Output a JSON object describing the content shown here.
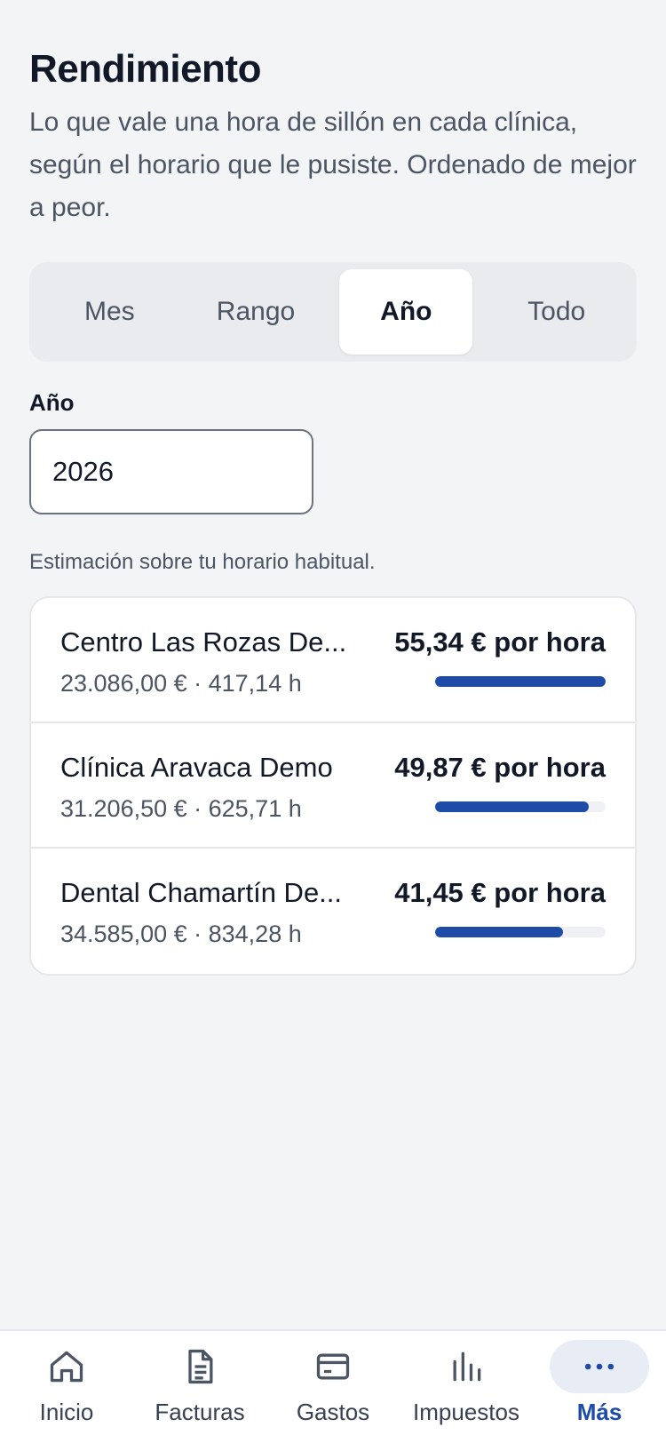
{
  "header": {
    "title": "Rendimiento",
    "subtitle": "Lo que vale una hora de sillón en cada clínica, según el horario que le pusiste. Ordenado de mejor a peor."
  },
  "segments": [
    {
      "label": "Mes",
      "active": false
    },
    {
      "label": "Rango",
      "active": false
    },
    {
      "label": "Año",
      "active": true
    },
    {
      "label": "Todo",
      "active": false
    }
  ],
  "year_field": {
    "label": "Año",
    "value": "2026"
  },
  "note": "Estimación sobre tu horario habitual.",
  "clinics": [
    {
      "name": "Centro Las Rozas De...",
      "stats": "23.086,00 € · 417,14 h",
      "rate": "55,34 € por hora",
      "bar_fraction": 1.0
    },
    {
      "name": "Clínica Aravaca Demo",
      "stats": "31.206,50 € · 625,71 h",
      "rate": "49,87 € por hora",
      "bar_fraction": 0.9
    },
    {
      "name": "Dental Chamartín De...",
      "stats": "34.585,00 € · 834,28 h",
      "rate": "41,45 € por hora",
      "bar_fraction": 0.75
    }
  ],
  "colors": {
    "accent": "#1e4aa8",
    "bar_track": "#eef0f3",
    "background": "#f3f4f6"
  },
  "nav": [
    {
      "label": "Inicio",
      "icon": "home-icon",
      "active": false
    },
    {
      "label": "Facturas",
      "icon": "document-icon",
      "active": false
    },
    {
      "label": "Gastos",
      "icon": "card-icon",
      "active": false
    },
    {
      "label": "Impuestos",
      "icon": "bar-chart-icon",
      "active": false
    },
    {
      "label": "Más",
      "icon": "more-icon",
      "active": true
    }
  ]
}
